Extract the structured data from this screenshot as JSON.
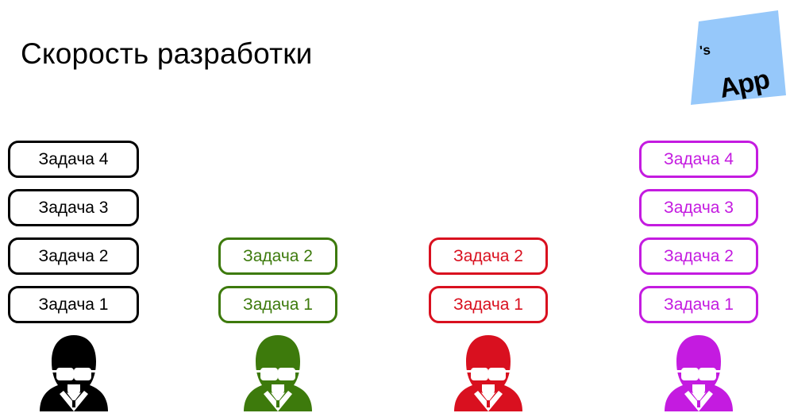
{
  "slide": {
    "title": "Скорость разработки",
    "background_color": "#ffffff"
  },
  "logo": {
    "name": "App's",
    "text_main": "App",
    "text_sup": "'s",
    "shape_color": "#96C8FA",
    "text_color": "#000000"
  },
  "board": {
    "columns": [
      {
        "id": "column-1",
        "color": "#000000",
        "avatar_color": "#000000",
        "cards": [
          "Задача 4",
          "Задача 3",
          "Задача 2",
          "Задача 1"
        ],
        "card_count": 4
      },
      {
        "id": "column-2",
        "color": "#3D7A0C",
        "avatar_color": "#3D7A0C",
        "cards": [
          "Задача 2",
          "Задача 1"
        ],
        "card_count": 2
      },
      {
        "id": "column-3",
        "color": "#D9101F",
        "avatar_color": "#D9101F",
        "cards": [
          "Задача 2",
          "Задача 1"
        ],
        "card_count": 2
      },
      {
        "id": "column-4",
        "color": "#C41BE0",
        "avatar_color": "#C41BE0",
        "cards": [
          "Задача 4",
          "Задача 3",
          "Задача 2",
          "Задача 1"
        ],
        "card_count": 4
      }
    ],
    "avatar_icon_name": "bearded-person-with-glasses-icon"
  }
}
